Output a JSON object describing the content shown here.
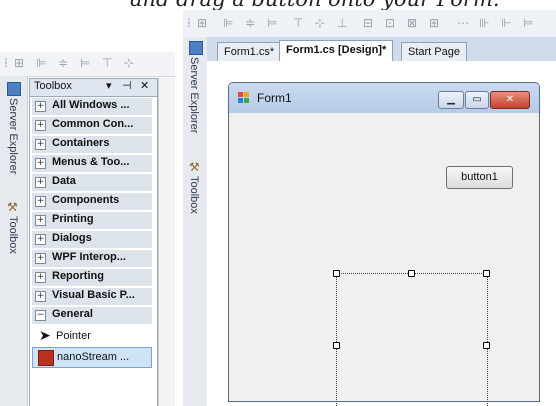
{
  "caption": "and drag a button onto your Form.",
  "left_window": {
    "vertical_tabs": [
      "Server Explorer",
      "Toolbox"
    ],
    "toolbox": {
      "title": "Toolbox",
      "header_buttons": [
        "▾",
        "⊣",
        "✕"
      ],
      "categories": [
        {
          "expander": "+",
          "label": "All Windows ..."
        },
        {
          "expander": "+",
          "label": "Common Con..."
        },
        {
          "expander": "+",
          "label": "Containers"
        },
        {
          "expander": "+",
          "label": "Menus & Too..."
        },
        {
          "expander": "+",
          "label": "Data"
        },
        {
          "expander": "+",
          "label": "Components"
        },
        {
          "expander": "+",
          "label": "Printing"
        },
        {
          "expander": "+",
          "label": "Dialogs"
        },
        {
          "expander": "+",
          "label": "WPF Interop..."
        },
        {
          "expander": "+",
          "label": "Reporting"
        },
        {
          "expander": "+",
          "label": "Visual Basic P..."
        },
        {
          "expander": "−",
          "label": "General"
        }
      ],
      "items": [
        {
          "icon": "pointer-arrow-icon",
          "label": "Pointer"
        },
        {
          "icon": "nanostream-icon",
          "label": "nanoStream ..."
        }
      ]
    }
  },
  "right_window": {
    "vertical_tabs": [
      "Server Explorer",
      "Toolbox"
    ],
    "tabs": [
      {
        "label": "Form1.cs*",
        "active": false
      },
      {
        "label": "Form1.cs [Design]*",
        "active": true
      },
      {
        "label": "Start Page",
        "active": false
      }
    ],
    "form": {
      "title": "Form1",
      "caption_buttons": [
        "minimize",
        "maximize",
        "close"
      ],
      "button_label": "button1"
    }
  },
  "colors": {
    "toolbox_category_bg": "#dde3ea",
    "tab_strip_bg": "#cfdaea",
    "form_titlebar": "#b6cbe7",
    "close_button": "#c2432e"
  }
}
